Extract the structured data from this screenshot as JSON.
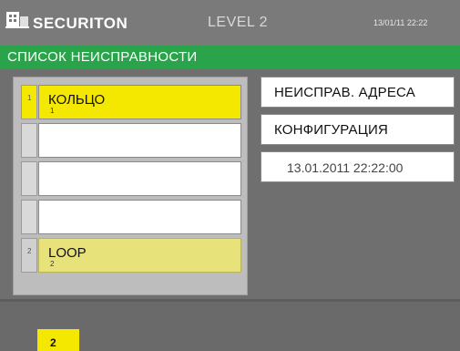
{
  "header": {
    "brand": "SECURITON",
    "level": "LEVEL 2",
    "datetime": "13/01/11 22:22",
    "logo_icon": "building-icon"
  },
  "title": "СПИСОК НЕИСПРАВНОСТИ",
  "list": {
    "slots": [
      {
        "num": "1",
        "name": "КОЛЬЦО",
        "sub": "1"
      },
      {
        "num": "",
        "name": "",
        "sub": ""
      },
      {
        "num": "",
        "name": "",
        "sub": ""
      },
      {
        "num": "",
        "name": "",
        "sub": ""
      },
      {
        "num": "2",
        "name": "LOOP",
        "sub": "2"
      }
    ]
  },
  "right": {
    "fault_address_label": "НЕИСПРАВ. АДРЕСА",
    "config_label": "КОНФИГУРАЦИЯ",
    "timestamp": "13.01.2011 22:22:00"
  },
  "footer": {
    "page": "2"
  },
  "colors": {
    "header_bg": "#7a7a7a",
    "title_green": "#2aa44a",
    "active_yellow": "#f5e800",
    "loop_yellow": "#e8e27a",
    "panel_gray": "#bdbdbd"
  }
}
